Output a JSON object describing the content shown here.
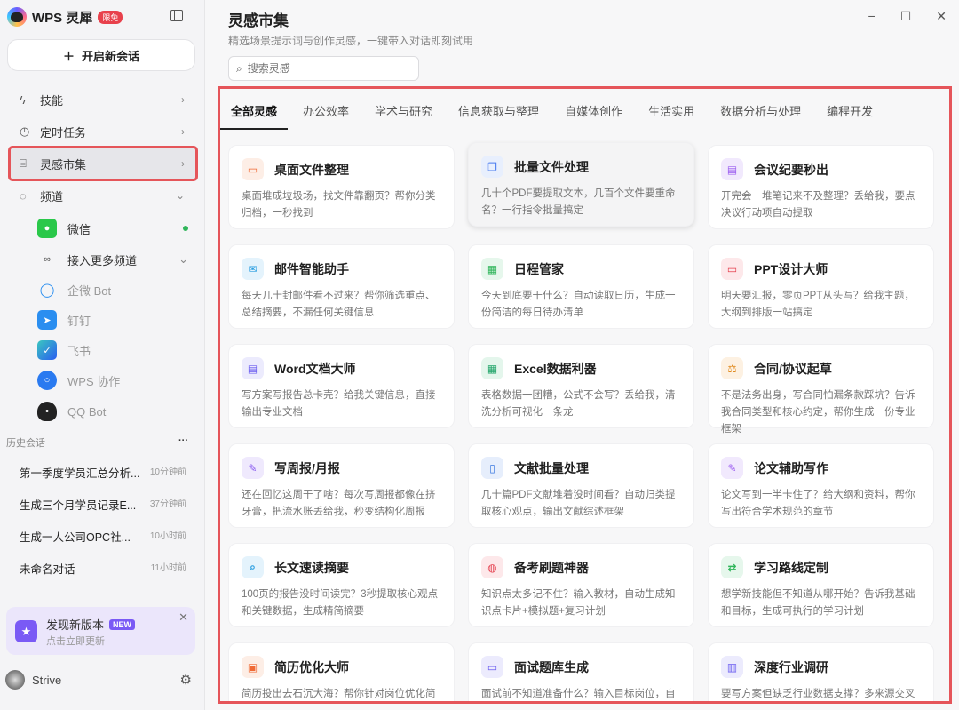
{
  "app": {
    "name": "WPS 灵犀",
    "badge": "限免"
  },
  "sidebar": {
    "new_chat": "开启新会话",
    "nav": [
      {
        "label": "技能"
      },
      {
        "label": "定时任务"
      },
      {
        "label": "灵感市集"
      },
      {
        "label": "频道"
      }
    ],
    "channels": [
      {
        "label": "微信"
      },
      {
        "label": "接入更多频道"
      },
      {
        "label": "企微 Bot"
      },
      {
        "label": "钉钉"
      },
      {
        "label": "飞书"
      },
      {
        "label": "WPS 协作"
      },
      {
        "label": "QQ Bot"
      }
    ],
    "history_title": "历史会话",
    "history": [
      {
        "title": "第一季度学员汇总分析...",
        "time": "10分钟前"
      },
      {
        "title": "生成三个月学员记录E...",
        "time": "37分钟前"
      },
      {
        "title": "生成一人公司OPC社...",
        "time": "10小时前"
      },
      {
        "title": "未命名对话",
        "time": "11小时前"
      }
    ],
    "update": {
      "title": "发现新版本",
      "badge": "NEW",
      "subtitle": "点击立即更新"
    },
    "user": "Strive"
  },
  "main": {
    "title": "灵感市集",
    "subtitle": "精选场景提示词与创作灵感，一键带入对话即刻试用",
    "search_placeholder": "搜索灵感",
    "tabs": [
      "全部灵感",
      "办公效率",
      "学术与研究",
      "信息获取与整理",
      "自媒体创作",
      "生活实用",
      "数据分析与处理",
      "编程开发"
    ],
    "cards": [
      {
        "title": "桌面文件整理",
        "desc": "桌面堆成垃圾场，找文件靠翻页？帮你分类归档，一秒找到",
        "icon": "folder-icon",
        "color": "#f06a35",
        "bg": "#fdeee6"
      },
      {
        "title": "批量文件处理",
        "desc": "几十个PDF要提取文本，几百个文件要重命名？一行指令批量搞定",
        "icon": "files-icon",
        "color": "#4a7cf0",
        "bg": "#e8effd"
      },
      {
        "title": "会议纪要秒出",
        "desc": "开完会一堆笔记来不及整理？丢给我，要点决议行动项自动提取",
        "icon": "clipboard-icon",
        "color": "#9b5cf0",
        "bg": "#f1e9fd"
      },
      {
        "title": "邮件智能助手",
        "desc": "每天几十封邮件看不过来？帮你筛选重点、总结摘要，不漏任何关键信息",
        "icon": "mail-icon",
        "color": "#2a9ee0",
        "bg": "#e4f3fc"
      },
      {
        "title": "日程管家",
        "desc": "今天到底要干什么？自动读取日历，生成一份简洁的每日待办清单",
        "icon": "calendar-icon",
        "color": "#2fb55a",
        "bg": "#e6f7ec"
      },
      {
        "title": "PPT设计大师",
        "desc": "明天要汇报，零页PPT从头写？给我主题，大纲到排版一站搞定",
        "icon": "presentation-icon",
        "color": "#e5414f",
        "bg": "#fde8ea"
      },
      {
        "title": "Word文档大师",
        "desc": "写方案写报告总卡壳？给我关键信息，直接输出专业文档",
        "icon": "document-icon",
        "color": "#6a5cf0",
        "bg": "#ecebfd"
      },
      {
        "title": "Excel数据利器",
        "desc": "表格数据一团糟，公式不会写？丢给我，清洗分析可视化一条龙",
        "icon": "table-icon",
        "color": "#22a56a",
        "bg": "#e4f6ec"
      },
      {
        "title": "合同/协议起草",
        "desc": "不是法务出身，写合同怕漏条款踩坑？告诉我合同类型和核心约定，帮你生成一份专业框架",
        "icon": "scale-icon",
        "color": "#e08a1e",
        "bg": "#fdf1e2"
      },
      {
        "title": "写周报/月报",
        "desc": "还在回忆这周干了啥？每次写周报都像在挤牙膏，把流水账丢给我，秒变结构化周报",
        "icon": "edit-icon",
        "color": "#8a5cf0",
        "bg": "#efe9fd"
      },
      {
        "title": "文献批量处理",
        "desc": "几十篇PDF文献堆着没时间看？自动归类提取核心观点，输出文献综述框架",
        "icon": "book-icon",
        "color": "#3a78e0",
        "bg": "#e6eefc"
      },
      {
        "title": "论文辅助写作",
        "desc": "论文写到一半卡住了？给大纲和资料，帮你写出符合学术规范的章节",
        "icon": "pen-icon",
        "color": "#9b5cf0",
        "bg": "#f1e9fd"
      },
      {
        "title": "长文速读摘要",
        "desc": "100页的报告没时间读完？3秒提取核心观点和关键数据，生成精简摘要",
        "icon": "search-doc-icon",
        "color": "#2a9ee0",
        "bg": "#e4f3fc"
      },
      {
        "title": "备考刷题神器",
        "desc": "知识点太多记不住？输入教材，自动生成知识点卡片+模拟题+复习计划",
        "icon": "brain-icon",
        "color": "#e5414f",
        "bg": "#fde8ea"
      },
      {
        "title": "学习路线定制",
        "desc": "想学新技能但不知道从哪开始？告诉我基础和目标，生成可执行的学习计划",
        "icon": "route-icon",
        "color": "#2fb55a",
        "bg": "#e6f7ec"
      },
      {
        "title": "简历优化大师",
        "desc": "简历投出去石沉大海？帮你针对岗位优化简",
        "icon": "resume-icon",
        "color": "#f06a35",
        "bg": "#fdeee6"
      },
      {
        "title": "面试题库生成",
        "desc": "面试前不知道准备什么？输入目标岗位，自动",
        "icon": "chat-icon",
        "color": "#6a5cf0",
        "bg": "#ecebfd"
      },
      {
        "title": "深度行业调研",
        "desc": "要写方案但缺乏行业数据支撑？多来源交叉核",
        "icon": "building-icon",
        "color": "#6a5cf0",
        "bg": "#ecebfd"
      }
    ]
  }
}
